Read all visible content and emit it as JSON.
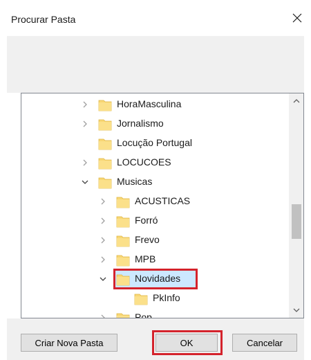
{
  "window": {
    "title": "Procurar Pasta"
  },
  "tree": {
    "items": [
      {
        "label": "HoraMasculina",
        "level": 0,
        "expander": "collapsed"
      },
      {
        "label": "Jornalismo",
        "level": 0,
        "expander": "collapsed"
      },
      {
        "label": "Locução Portugal",
        "level": 0,
        "expander": "none"
      },
      {
        "label": "LOCUCOES",
        "level": 0,
        "expander": "collapsed"
      },
      {
        "label": "Musicas",
        "level": 0,
        "expander": "expanded"
      },
      {
        "label": "ACUSTICAS",
        "level": 1,
        "expander": "collapsed"
      },
      {
        "label": "Forró",
        "level": 1,
        "expander": "collapsed"
      },
      {
        "label": "Frevo",
        "level": 1,
        "expander": "collapsed"
      },
      {
        "label": "MPB",
        "level": 1,
        "expander": "collapsed"
      },
      {
        "label": "Novidades",
        "level": 1,
        "expander": "expanded",
        "selected": true
      },
      {
        "label": "PkInfo",
        "level": 2,
        "expander": "none"
      },
      {
        "label": "Pop",
        "level": 1,
        "expander": "collapsed"
      }
    ]
  },
  "buttons": {
    "new_folder": "Criar Nova Pasta",
    "ok": "OK",
    "cancel": "Cancelar"
  },
  "colors": {
    "folder": "#f8d775",
    "selection": "#cce8ff",
    "highlight": "#d4232c"
  }
}
